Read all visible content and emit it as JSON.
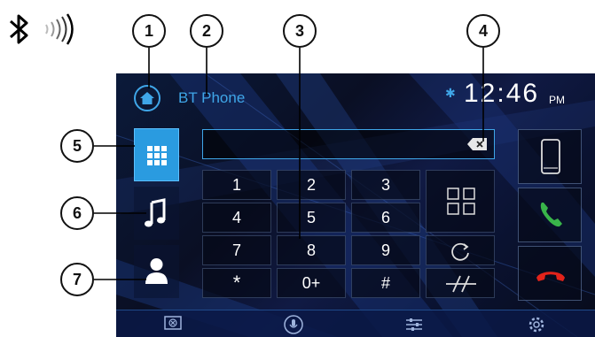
{
  "title": "BT Phone",
  "clock": {
    "time": "12:46",
    "ampm": "PM"
  },
  "callouts": [
    "1",
    "2",
    "3",
    "4",
    "5",
    "6",
    "7"
  ],
  "keypad": {
    "keys": [
      "1",
      "2",
      "3",
      "4",
      "5",
      "6",
      "7",
      "8",
      "9",
      "*",
      "0+",
      "#"
    ]
  },
  "icons": {
    "bluetooth_signal": "bluetooth-signal-icon",
    "home": "home-icon",
    "status_bluetooth": "bluetooth-icon",
    "backspace": "backspace-icon",
    "keypad_tab": "keypad-icon",
    "music_tab": "music-icon",
    "contacts_tab": "contact-icon",
    "grid": "grid-icon",
    "redial": "redial-icon",
    "mute": "mute-icon",
    "phone_device": "smartphone-icon",
    "call": "call-icon",
    "hangup": "hangup-icon",
    "screen_off": "screen-off-icon",
    "voice": "microphone-icon",
    "equalizer": "equalizer-icon",
    "settings": "gear-icon"
  },
  "colors": {
    "accent": "#3fa6e8",
    "call_green": "#39b54a",
    "hangup_red": "#e2231a"
  }
}
